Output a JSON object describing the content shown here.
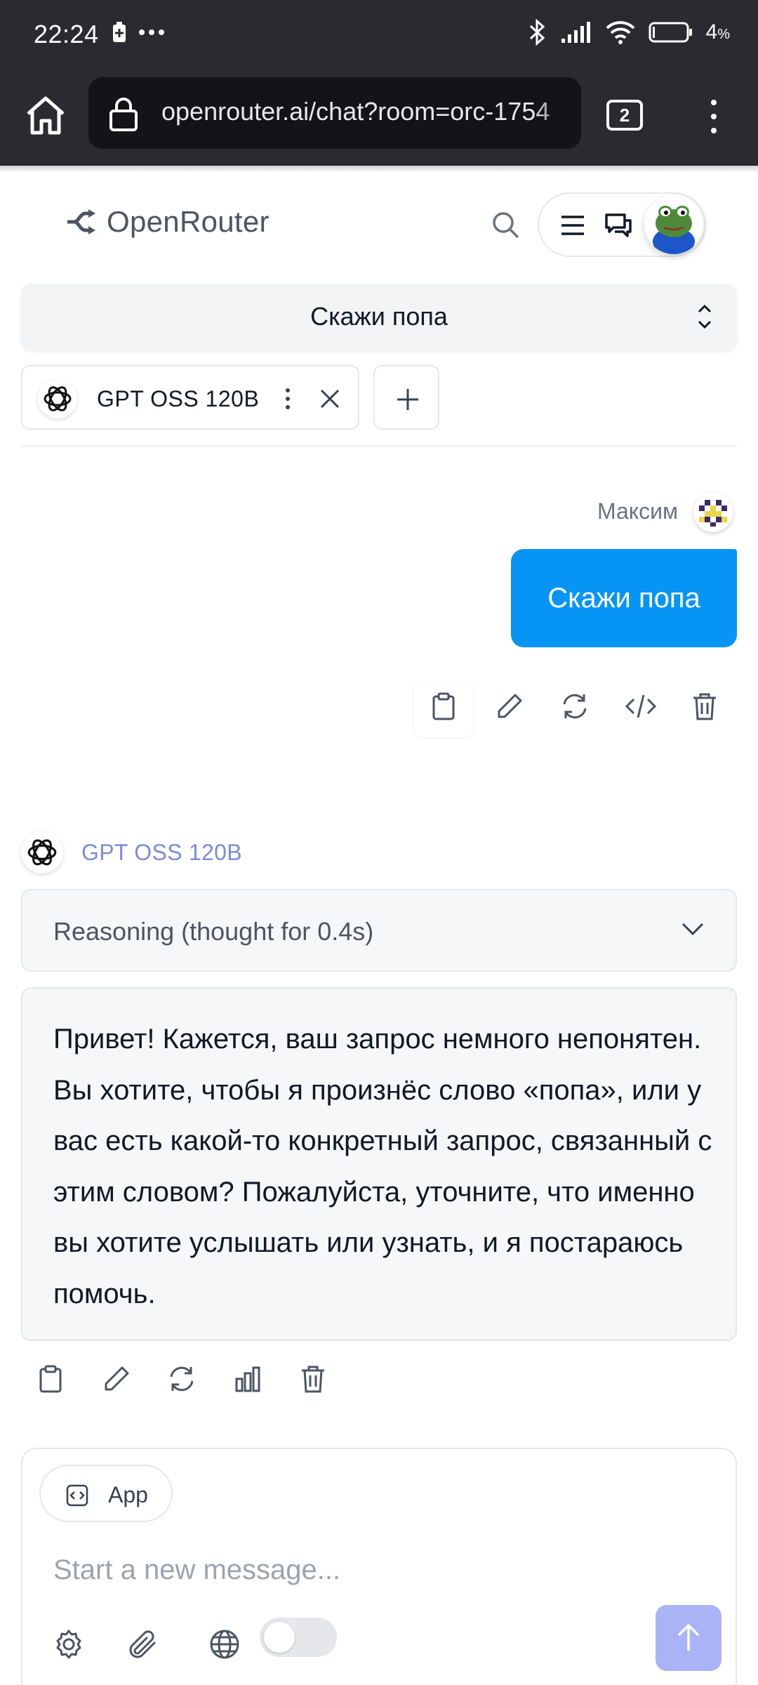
{
  "status_bar": {
    "time": "22:24",
    "battery_percent": "4",
    "battery_unit": "%"
  },
  "browser": {
    "url": "openrouter.ai/chat?room=orc-1754",
    "tab_count": "2"
  },
  "header": {
    "logo_text": "OpenRouter"
  },
  "room": {
    "title": "Скажи попа"
  },
  "model_chip": {
    "name": "GPT OSS 120B"
  },
  "user_message": {
    "author": "Максим",
    "text": "Скажи попа"
  },
  "assistant": {
    "model_name": "GPT OSS 120B",
    "reasoning_label": "Reasoning (thought for 0.4s)",
    "text": "Привет! Кажется, ваш запрос немного непонятен. Вы хотите, чтобы я произнёс слово «попа», или у вас есть какой‑то конкретный запрос, связанный с этим словом? Пожалуйста, уточните, что именно вы хотите услышать или узнать, и я постараюсь помочь."
  },
  "composer": {
    "app_label": "App",
    "placeholder": "Start a new message...",
    "web_search_enabled": false
  },
  "colors": {
    "user_bubble": "#0795f5",
    "model_name": "#7c8bd8",
    "send_button": "#aab3f5",
    "browser_bar": "#2a2a30"
  },
  "icons": [
    "home-icon",
    "lock-icon",
    "search-icon",
    "menu-icon",
    "chat-icon",
    "chevrons-up-down-icon",
    "openai-icon",
    "more-vertical-icon",
    "close-icon",
    "plus-icon",
    "copy-icon",
    "edit-icon",
    "refresh-icon",
    "code-icon",
    "trash-icon",
    "bar-chart-icon",
    "chevron-down-icon",
    "settings-icon",
    "paperclip-icon",
    "globe-icon",
    "arrow-up-icon"
  ]
}
